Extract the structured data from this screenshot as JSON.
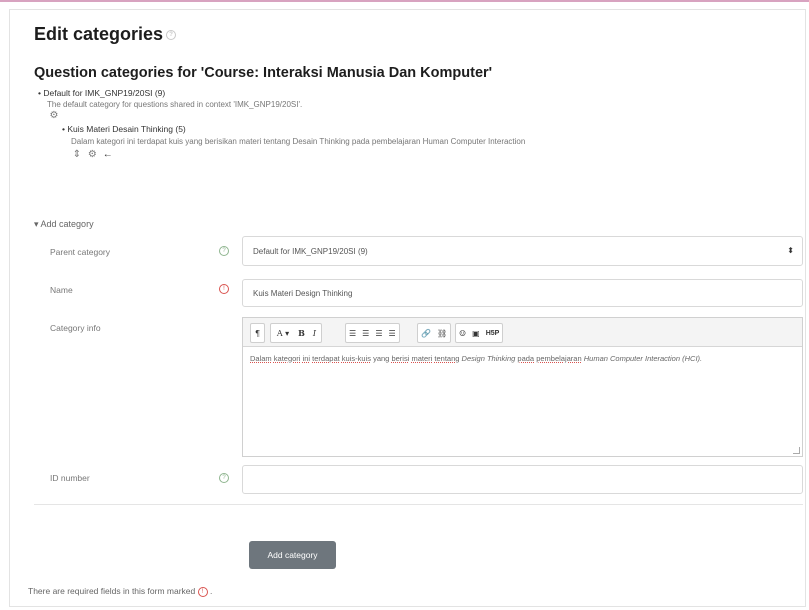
{
  "page_title": "Edit categories",
  "section_title": "Question categories for 'Course: Interaksi Manusia Dan Komputer'",
  "tree": {
    "parent": {
      "title": "Default for IMK_GNP19/20SI (9)",
      "description": "The default category for questions shared in context 'IMK_GNP19/20SI'."
    },
    "child": {
      "title": "Kuis Materi Desain Thinking (5)",
      "description": "Dalam kategori ini terdapat kuis yang berisikan materi tentang Desain Thinking pada pembelajaran Human Computer Interaction"
    }
  },
  "form": {
    "section_toggle": "Add category",
    "parent_label": "Parent category",
    "parent_value": "Default for IMK_GNP19/20SI (9)",
    "name_label": "Name",
    "name_value": "Kuis Materi Design Thinking",
    "info_label": "Category info",
    "info_text": {
      "w1": "Dalam",
      "w2": "kategori",
      "w3": "ini",
      "w4": "terdapat",
      "w5": "kuis-kuis",
      "w6": "yang",
      "w7": "berisi",
      "w8": "materi",
      "w9": "tentang",
      "w10": "Design Thinking",
      "w11": "pada",
      "w12": "pembelajaran",
      "w13": "Human Computer Interaction (HCI)."
    },
    "id_label": "ID number",
    "id_value": "",
    "submit_label": "Add category",
    "required_note": "There are required fields in this form marked"
  },
  "toolbar": {
    "paragraph": "¶",
    "font": "A ▾",
    "bold": "B",
    "italic": "I",
    "h5p": "H5P"
  },
  "icons": {
    "help": "question-circle-icon",
    "required": "exclamation-circle-icon",
    "settings": "gear-icon",
    "move": "arrow-up-down-icon",
    "left": "arrow-left-icon"
  },
  "colors": {
    "required": "#d9534f",
    "button": "#6e767d",
    "help": "#8fb58f"
  }
}
